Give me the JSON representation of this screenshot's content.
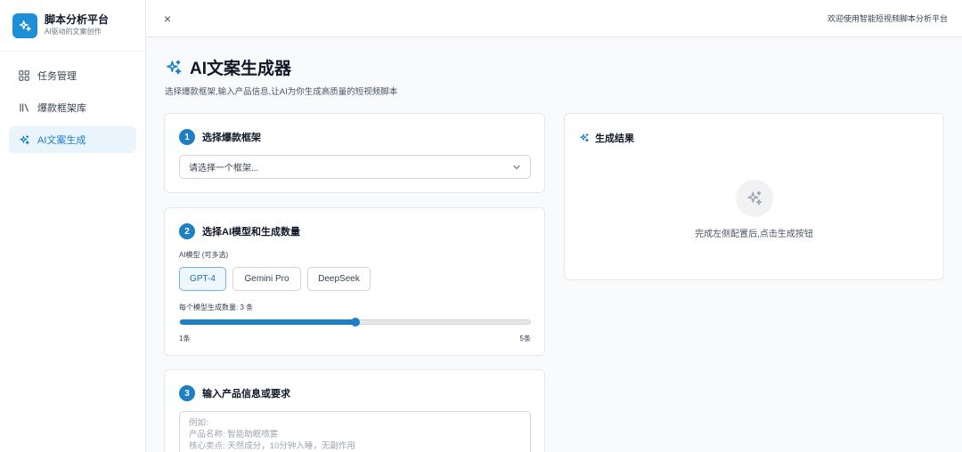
{
  "brand": {
    "title": "脚本分析平台",
    "subtitle": "AI驱动的文案创作"
  },
  "nav": [
    {
      "label": "任务管理",
      "icon": "grid-icon"
    },
    {
      "label": "爆款框架库",
      "icon": "library-icon"
    },
    {
      "label": "AI文案生成",
      "icon": "sparkles-icon",
      "active": true
    }
  ],
  "topbar": {
    "close": "×",
    "welcome": "欢迎使用智能短视频脚本分析平台"
  },
  "page": {
    "title": "AI文案生成器",
    "description": "选择爆款框架,输入产品信息,让AI为你生成高质量的短视频脚本"
  },
  "step1": {
    "number": "1",
    "title": "选择爆款框架",
    "placeholder": "请选择一个框架..."
  },
  "step2": {
    "number": "2",
    "title": "选择AI模型和生成数量",
    "models_label": "AI模型 (可多选)",
    "models": [
      "GPT-4",
      "Gemini Pro",
      "DeepSeek"
    ],
    "selected_model": "GPT-4",
    "count_label": "每个模型生成数量: 3 条",
    "count_value": 3,
    "count_min": 1,
    "count_max": 5,
    "min_label": "1条",
    "max_label": "5条"
  },
  "step3": {
    "number": "3",
    "title": "输入产品信息或要求",
    "placeholder": "例如:\n产品名称: 智能助眠喷雾\n核心卖点: 天然成分，10分钟入睡，无副作用"
  },
  "result": {
    "title": "生成结果",
    "empty_text": "完成左侧配置后,点击生成按钮"
  },
  "colors": {
    "accent": "#1d7fc4",
    "brand": "#1d8fd8",
    "active_bg": "#eaf4fc"
  }
}
